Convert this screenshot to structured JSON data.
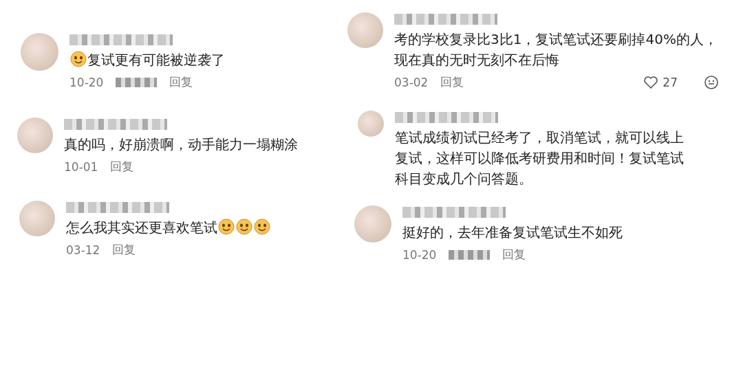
{
  "columns": [
    {
      "comments": [
        {
          "segments": [
            {
              "kind": "emoji"
            },
            {
              "kind": "text",
              "text": "复试更有可能被逆袭了"
            }
          ],
          "date": "10-20",
          "location_blurred": true,
          "reply": "回复"
        },
        {
          "segments": [
            {
              "kind": "text",
              "text": "真的吗，好崩溃啊，动手能力一塌糊涂"
            }
          ],
          "date": "10-01",
          "reply": "回复"
        },
        {
          "segments": [
            {
              "kind": "text",
              "text": "怎么我其实还更喜欢笔试"
            },
            {
              "kind": "emoji"
            },
            {
              "kind": "emoji"
            },
            {
              "kind": "emoji"
            }
          ],
          "date": "03-12",
          "reply": "回复"
        }
      ]
    },
    {
      "comments": [
        {
          "segments": [
            {
              "kind": "text",
              "text": "考的学校复录比3比1，复试笔试还要刷掉40%的人，现在真的无时无刻不在后悔"
            }
          ],
          "date": "03-02",
          "reply": "回复",
          "likes": "27"
        },
        {
          "segments": [
            {
              "kind": "text",
              "text": "笔试成绩初试已经考了，取消笔试，就可以线上复试，这样可以降低考研费用和时间！复试笔试科目变成几个问答题。"
            }
          ]
        },
        {
          "segments": [
            {
              "kind": "text",
              "text": "挺好的，去年准备复试笔试生不如死"
            }
          ],
          "date": "10-20",
          "location_blurred": true,
          "reply": "回复"
        }
      ]
    }
  ]
}
